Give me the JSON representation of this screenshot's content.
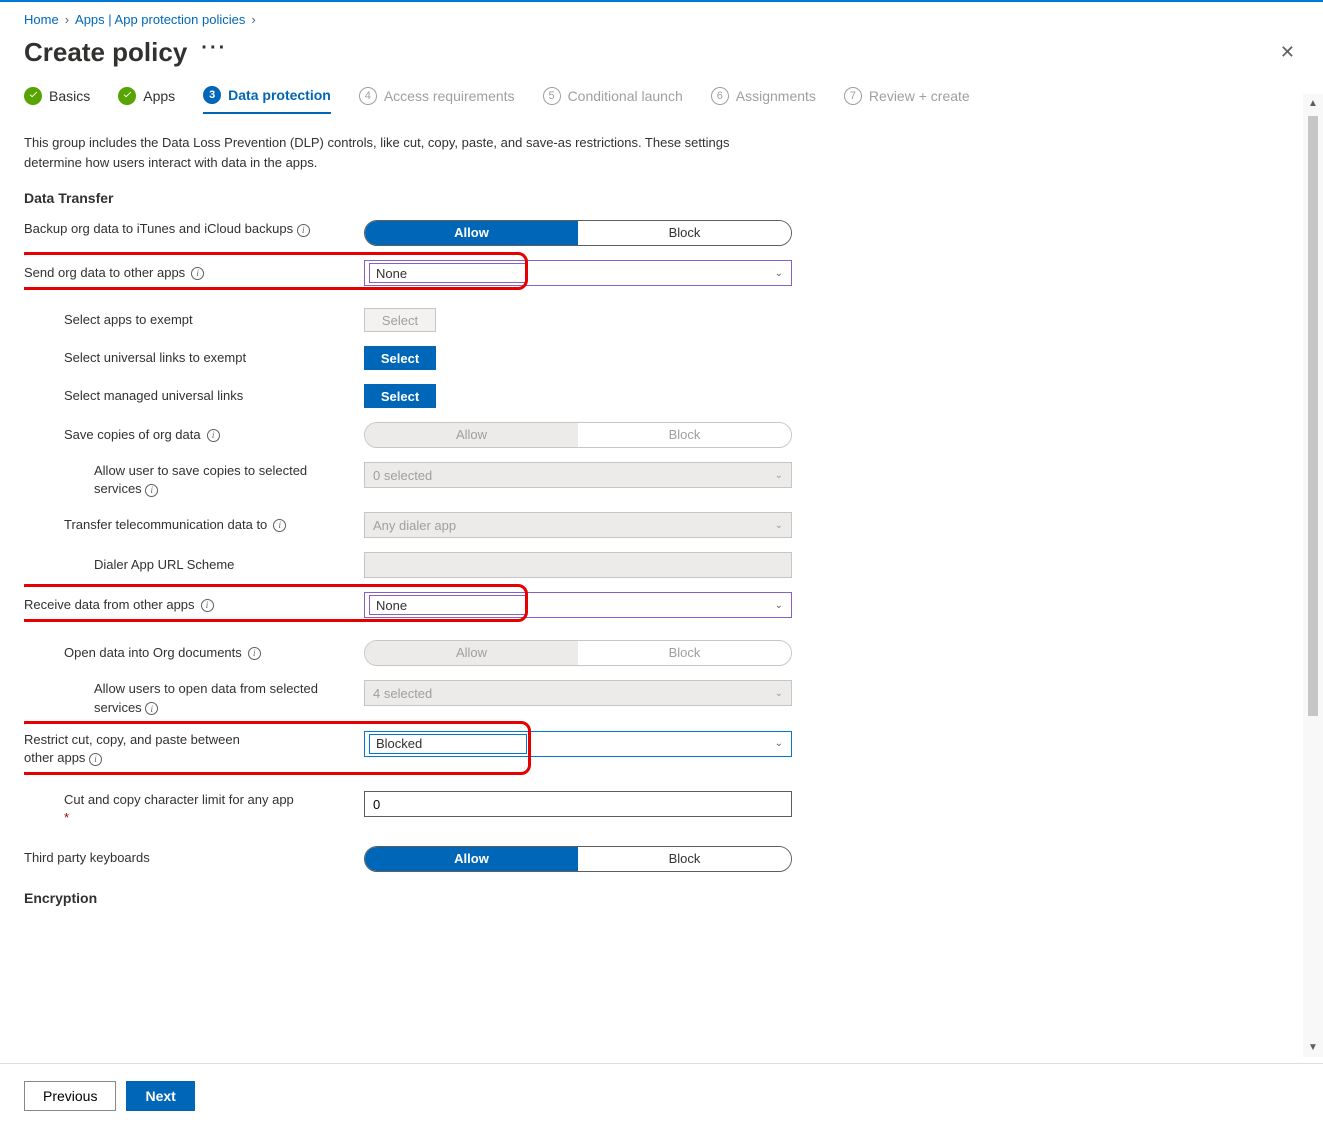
{
  "breadcrumb": {
    "home": "Home",
    "apps": "Apps | App protection policies"
  },
  "page_title": "Create policy",
  "steps": [
    {
      "num": "1",
      "label": "Basics"
    },
    {
      "num": "2",
      "label": "Apps"
    },
    {
      "num": "3",
      "label": "Data protection"
    },
    {
      "num": "4",
      "label": "Access requirements"
    },
    {
      "num": "5",
      "label": "Conditional launch"
    },
    {
      "num": "6",
      "label": "Assignments"
    },
    {
      "num": "7",
      "label": "Review + create"
    }
  ],
  "description": "This group includes the Data Loss Prevention (DLP) controls, like cut, copy, paste, and save-as restrictions. These settings determine how users interact with data in the apps.",
  "sections": {
    "data_transfer_h": "Data Transfer",
    "encryption_h": "Encryption"
  },
  "fields": {
    "backup_label": "Backup org data to iTunes and iCloud backups",
    "backup_allow": "Allow",
    "backup_block": "Block",
    "send_label": "Send org data to other apps",
    "send_value": "None",
    "exempt_apps_label": "Select apps to exempt",
    "exempt_apps_btn": "Select",
    "universal_links_label": "Select universal links to exempt",
    "universal_links_btn": "Select",
    "managed_links_label": "Select managed universal links",
    "managed_links_btn": "Select",
    "save_copies_label": "Save copies of org data",
    "save_copies_allow": "Allow",
    "save_copies_block": "Block",
    "save_services_label": "Allow user to save copies to selected services",
    "save_services_value": "0 selected",
    "telecom_label": "Transfer telecommunication data to",
    "telecom_value": "Any dialer app",
    "dialer_label": "Dialer App URL Scheme",
    "receive_label": "Receive data from other apps",
    "receive_value": "None",
    "open_org_label": "Open data into Org documents",
    "open_org_allow": "Allow",
    "open_org_block": "Block",
    "open_services_label": "Allow users to open data from selected services",
    "open_services_value": "4 selected",
    "restrict_label_l1": "Restrict cut, copy, and paste between",
    "restrict_label_l2": "other apps",
    "restrict_value": "Blocked",
    "charlimit_label": "Cut and copy character limit for any app",
    "charlimit_value": "0",
    "third_kb_label": "Third party keyboards",
    "third_kb_allow": "Allow",
    "third_kb_block": "Block"
  },
  "footer": {
    "previous": "Previous",
    "next": "Next"
  }
}
